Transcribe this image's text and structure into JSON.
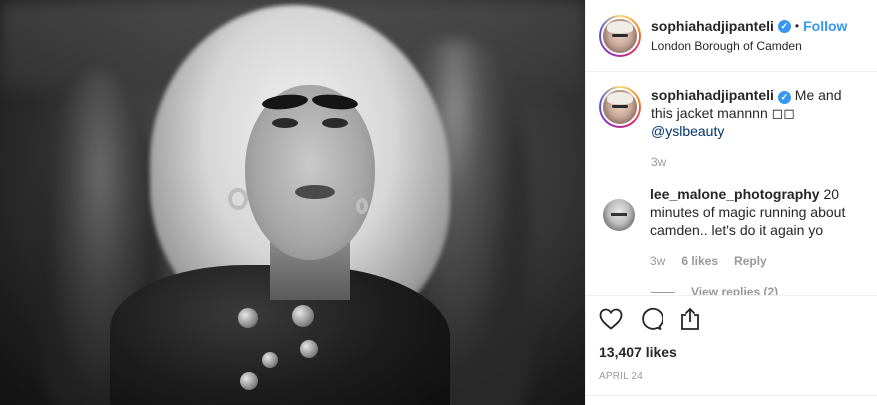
{
  "post": {
    "username": "sophiahadjipanteli",
    "verified_icon": "verified-badge-icon",
    "separator": "•",
    "follow_label": "Follow",
    "location": "London Borough of Camden",
    "accent_color": "#3897f0"
  },
  "caption": {
    "username": "sophiahadjipanteli",
    "text": " Me and this jacket mannnn ◻◻ ",
    "mention": "@yslbeauty",
    "time": "3w"
  },
  "comments": [
    {
      "username": "lee_malone_photography",
      "text": " 20 minutes of magic running about camden.. let's do it again yo",
      "time": "3w",
      "likes": "6 likes",
      "reply_label": "Reply",
      "view_replies": "View replies (2)"
    }
  ],
  "actions": {
    "like_icon": "heart-icon",
    "comment_icon": "comment-icon",
    "share_icon": "share-icon",
    "likes_count": "13,407 likes",
    "date": "April 24"
  }
}
